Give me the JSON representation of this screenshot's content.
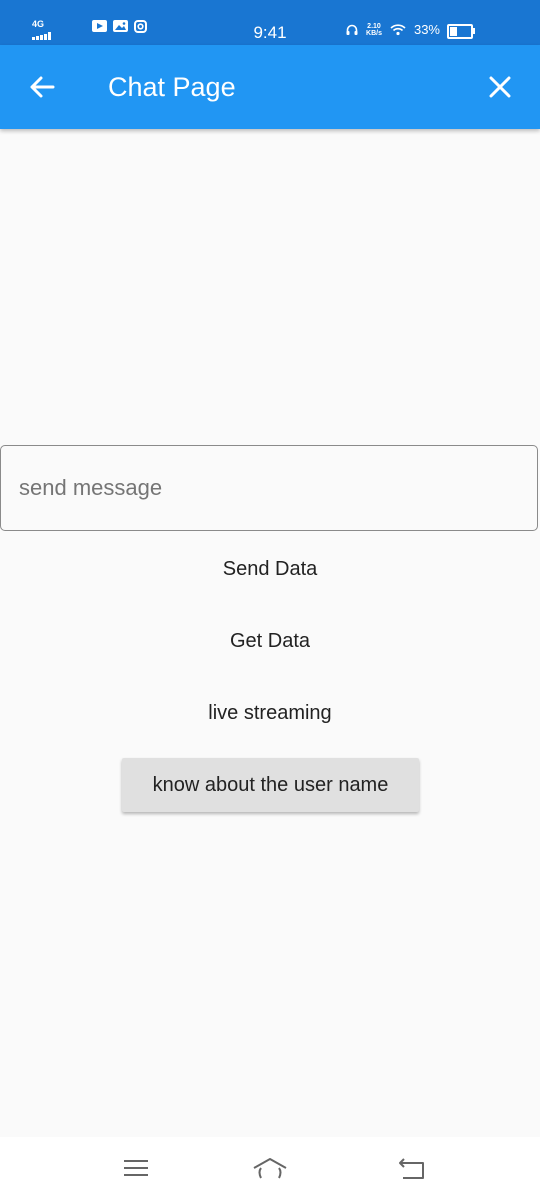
{
  "status_bar": {
    "network": "4G",
    "time": "9:41",
    "speed_value": "2.10",
    "speed_unit": "KB/s",
    "battery_percent": "33%",
    "battery_level": 0.33
  },
  "app_bar": {
    "title": "Chat Page",
    "back_icon": "arrow-left-icon",
    "close_icon": "close-icon",
    "color": "#2196f3"
  },
  "message_input": {
    "placeholder": "send message",
    "value": ""
  },
  "buttons": {
    "send_data": "Send Data",
    "get_data": "Get Data",
    "live_streaming": "live streaming",
    "know_user_name": "know about the user name"
  },
  "nav_bar": {
    "menu_icon": "menu-icon",
    "home_icon": "home-icon",
    "back_icon": "back-icon"
  }
}
